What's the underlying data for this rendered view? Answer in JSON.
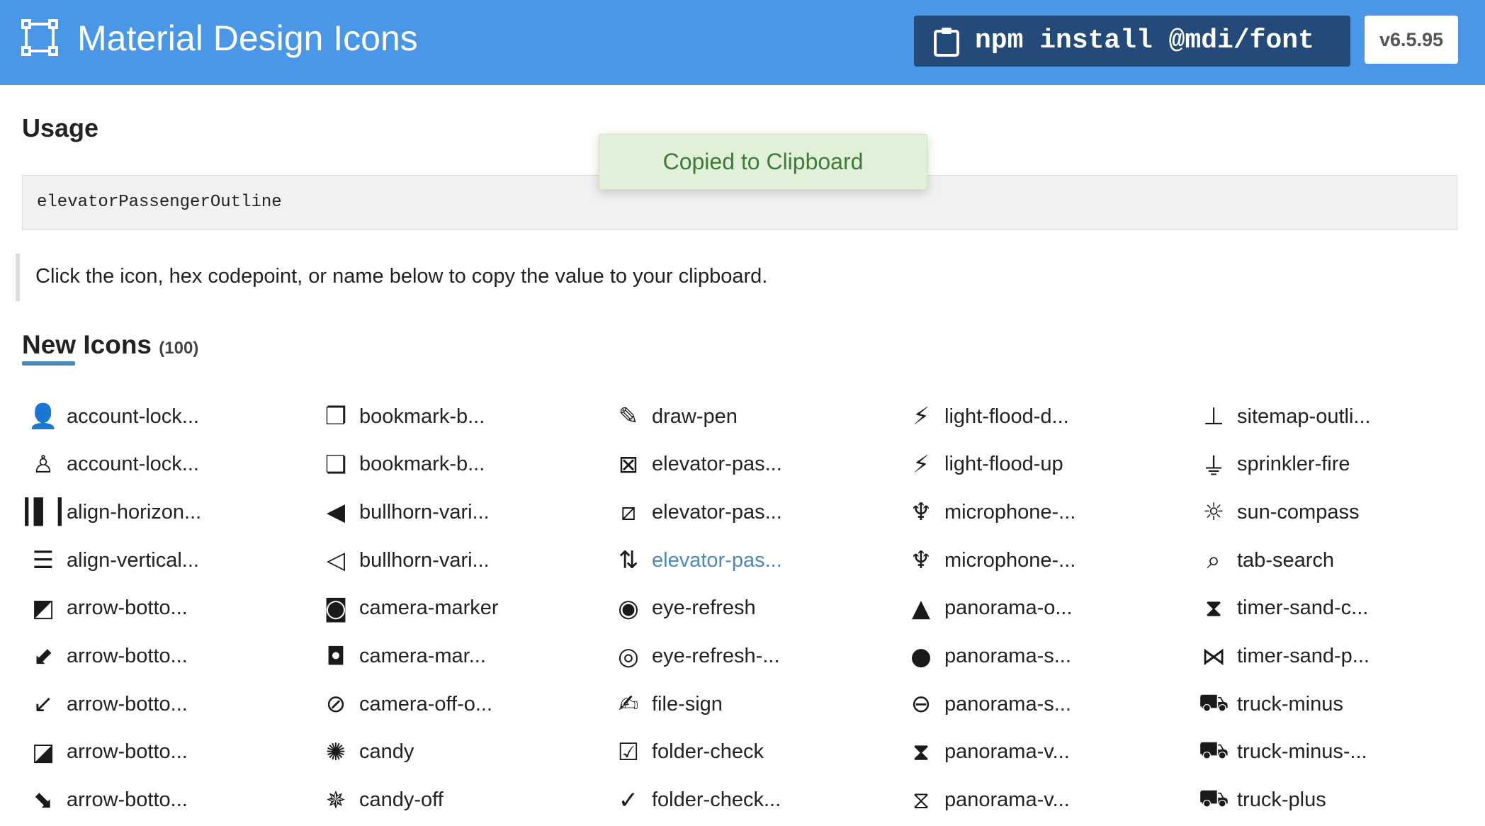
{
  "header": {
    "title": "Material Design Icons",
    "npm_command": "npm install @mdi/font",
    "version": "v6.5.95"
  },
  "usage": {
    "heading": "Usage",
    "code": "elevatorPassengerOutline"
  },
  "toast": {
    "text": "Copied to Clipboard"
  },
  "hint": "Click the icon, hex codepoint, or name below to copy the value to your clipboard.",
  "new_icons": {
    "heading": "New Icons",
    "count": "(100)"
  },
  "icons": [
    {
      "label": "account-lock...",
      "icon": "account-lock",
      "glyph": "👤"
    },
    {
      "label": "account-lock...",
      "icon": "account-lock-outline",
      "glyph": "♙"
    },
    {
      "label": "align-horizon...",
      "icon": "align-horizontal-distribute",
      "glyph": "┃▌┃"
    },
    {
      "label": "align-vertical...",
      "icon": "align-vertical-distribute",
      "glyph": "☰"
    },
    {
      "label": "arrow-botto...",
      "icon": "arrow-bottom-left-bold-box",
      "glyph": "◩"
    },
    {
      "label": "arrow-botto...",
      "icon": "arrow-bottom-left-bold-box-outline",
      "glyph": "⬋"
    },
    {
      "label": "arrow-botto...",
      "icon": "arrow-bottom-left-thin",
      "glyph": "↙"
    },
    {
      "label": "arrow-botto...",
      "icon": "arrow-bottom-right-bold-box",
      "glyph": "◪"
    },
    {
      "label": "arrow-botto...",
      "icon": "arrow-bottom-right-bold-box-outline",
      "glyph": "⬊"
    },
    {
      "label": "bookmark-b...",
      "icon": "bookmark-box-multiple",
      "glyph": "❐"
    },
    {
      "label": "bookmark-b...",
      "icon": "bookmark-box-multiple-outline",
      "glyph": "❏"
    },
    {
      "label": "bullhorn-vari...",
      "icon": "bullhorn-variant",
      "glyph": "◀"
    },
    {
      "label": "bullhorn-vari...",
      "icon": "bullhorn-variant-outline",
      "glyph": "◁"
    },
    {
      "label": "camera-marker",
      "icon": "camera-marker",
      "glyph": "◙"
    },
    {
      "label": "camera-mar...",
      "icon": "camera-marker-outline",
      "glyph": "◘"
    },
    {
      "label": "camera-off-o...",
      "icon": "camera-off-outline",
      "glyph": "⊘"
    },
    {
      "label": "candy",
      "icon": "candy",
      "glyph": "✺"
    },
    {
      "label": "candy-off",
      "icon": "candy-off",
      "glyph": "✵"
    },
    {
      "label": "draw-pen",
      "icon": "draw-pen",
      "glyph": "✎"
    },
    {
      "label": "elevator-pas...",
      "icon": "elevator-passenger-off",
      "glyph": "⊠"
    },
    {
      "label": "elevator-pas...",
      "icon": "elevator-passenger-off-outline",
      "glyph": "⧄"
    },
    {
      "label": "elevator-pas...",
      "icon": "elevator-passenger-outline",
      "glyph": "⇅",
      "active": true
    },
    {
      "label": "eye-refresh",
      "icon": "eye-refresh",
      "glyph": "◉"
    },
    {
      "label": "eye-refresh-...",
      "icon": "eye-refresh-outline",
      "glyph": "◎"
    },
    {
      "label": "file-sign",
      "icon": "file-sign",
      "glyph": "✍"
    },
    {
      "label": "folder-check",
      "icon": "folder-check",
      "glyph": "☑"
    },
    {
      "label": "folder-check...",
      "icon": "folder-check-outline",
      "glyph": "✓"
    },
    {
      "label": "light-flood-d...",
      "icon": "light-flood-down",
      "glyph": "⚡"
    },
    {
      "label": "light-flood-up",
      "icon": "light-flood-up",
      "glyph": "⚡"
    },
    {
      "label": "microphone-...",
      "icon": "microphone-question",
      "glyph": "♆"
    },
    {
      "label": "microphone-...",
      "icon": "microphone-question-outline",
      "glyph": "♆"
    },
    {
      "label": "panorama-o...",
      "icon": "panorama-outline",
      "glyph": "▲"
    },
    {
      "label": "panorama-s...",
      "icon": "panorama-sphere",
      "glyph": "●"
    },
    {
      "label": "panorama-s...",
      "icon": "panorama-sphere-outline",
      "glyph": "⊖"
    },
    {
      "label": "panorama-v...",
      "icon": "panorama-variant",
      "glyph": "⧗"
    },
    {
      "label": "panorama-v...",
      "icon": "panorama-variant-outline",
      "glyph": "⧖"
    },
    {
      "label": "sitemap-outli...",
      "icon": "sitemap-outline",
      "glyph": "⊥"
    },
    {
      "label": "sprinkler-fire",
      "icon": "sprinkler-fire",
      "glyph": "⏚"
    },
    {
      "label": "sun-compass",
      "icon": "sun-compass",
      "glyph": "☼"
    },
    {
      "label": "tab-search",
      "icon": "tab-search",
      "glyph": "⌕"
    },
    {
      "label": "timer-sand-c...",
      "icon": "timer-sand-complete",
      "glyph": "⧗"
    },
    {
      "label": "timer-sand-p...",
      "icon": "timer-sand-paused",
      "glyph": "⋈"
    },
    {
      "label": "truck-minus",
      "icon": "truck-minus",
      "glyph": "⛟"
    },
    {
      "label": "truck-minus-...",
      "icon": "truck-minus-outline",
      "glyph": "⛟"
    },
    {
      "label": "truck-plus",
      "icon": "truck-plus",
      "glyph": "⛟"
    }
  ]
}
